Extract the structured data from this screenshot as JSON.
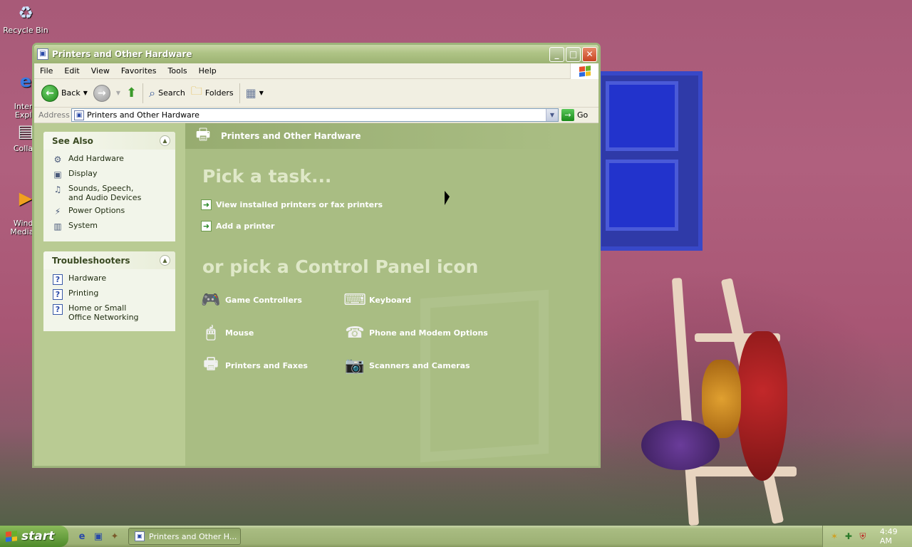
{
  "desktop": {
    "icons": [
      {
        "label": "Recycle Bin",
        "icon": "recycle-bin-icon",
        "glyph": "♻"
      },
      {
        "label": "Intern\nExplo",
        "icon": "internet-explorer-icon",
        "glyph": "e"
      },
      {
        "label": "Collab",
        "icon": "collab-icon",
        "glyph": "▤"
      },
      {
        "label": "Windo\nMedia P",
        "icon": "media-player-icon",
        "glyph": "▶"
      }
    ]
  },
  "window": {
    "title": "Printers and Other Hardware",
    "menu": [
      "File",
      "Edit",
      "View",
      "Favorites",
      "Tools",
      "Help"
    ],
    "toolbar": {
      "back_label": "Back",
      "search_label": "Search",
      "folders_label": "Folders"
    },
    "address": {
      "label": "Address",
      "value": "Printers and Other Hardware",
      "go_label": "Go"
    },
    "see_also": {
      "title": "See Also",
      "items": [
        {
          "label": "Add Hardware",
          "icon": "add-hardware-icon",
          "glyph": "⚙"
        },
        {
          "label": "Display",
          "icon": "display-icon",
          "glyph": "▣"
        },
        {
          "label": "Sounds, Speech, and Audio Devices",
          "icon": "sounds-icon",
          "glyph": "♫"
        },
        {
          "label": "Power Options",
          "icon": "power-options-icon",
          "glyph": "⚡"
        },
        {
          "label": "System",
          "icon": "system-icon",
          "glyph": "▥"
        }
      ]
    },
    "troubleshooters": {
      "title": "Troubleshooters",
      "items": [
        {
          "label": "Hardware"
        },
        {
          "label": "Printing"
        },
        {
          "label": "Home or Small Office Networking"
        }
      ]
    },
    "main": {
      "header": "Printers and Other Hardware",
      "pick_task": "Pick a task...",
      "tasks": [
        "View installed printers or fax printers",
        "Add a printer"
      ],
      "pick_icon": "or pick a Control Panel icon",
      "icons": [
        {
          "label": "Game Controllers",
          "icon": "game-controllers-icon",
          "glyph": "🎮"
        },
        {
          "label": "Keyboard",
          "icon": "keyboard-icon",
          "glyph": "⌨"
        },
        {
          "label": "Mouse",
          "icon": "mouse-icon",
          "glyph": "🖱"
        },
        {
          "label": "Phone and Modem Options",
          "icon": "phone-modem-icon",
          "glyph": "☎"
        },
        {
          "label": "Printers and Faxes",
          "icon": "printers-faxes-icon",
          "glyph": "🖶"
        },
        {
          "label": "Scanners and Cameras",
          "icon": "scanners-cameras-icon",
          "glyph": "📷"
        }
      ]
    }
  },
  "taskbar": {
    "start_label": "start",
    "task_button": "Printers and Other H...",
    "clock": "4:49 AM"
  },
  "colors": {
    "window_border": "#9cb37a",
    "content_bg": "#a9bd83",
    "left_pane_bg": "#b9cb93"
  }
}
